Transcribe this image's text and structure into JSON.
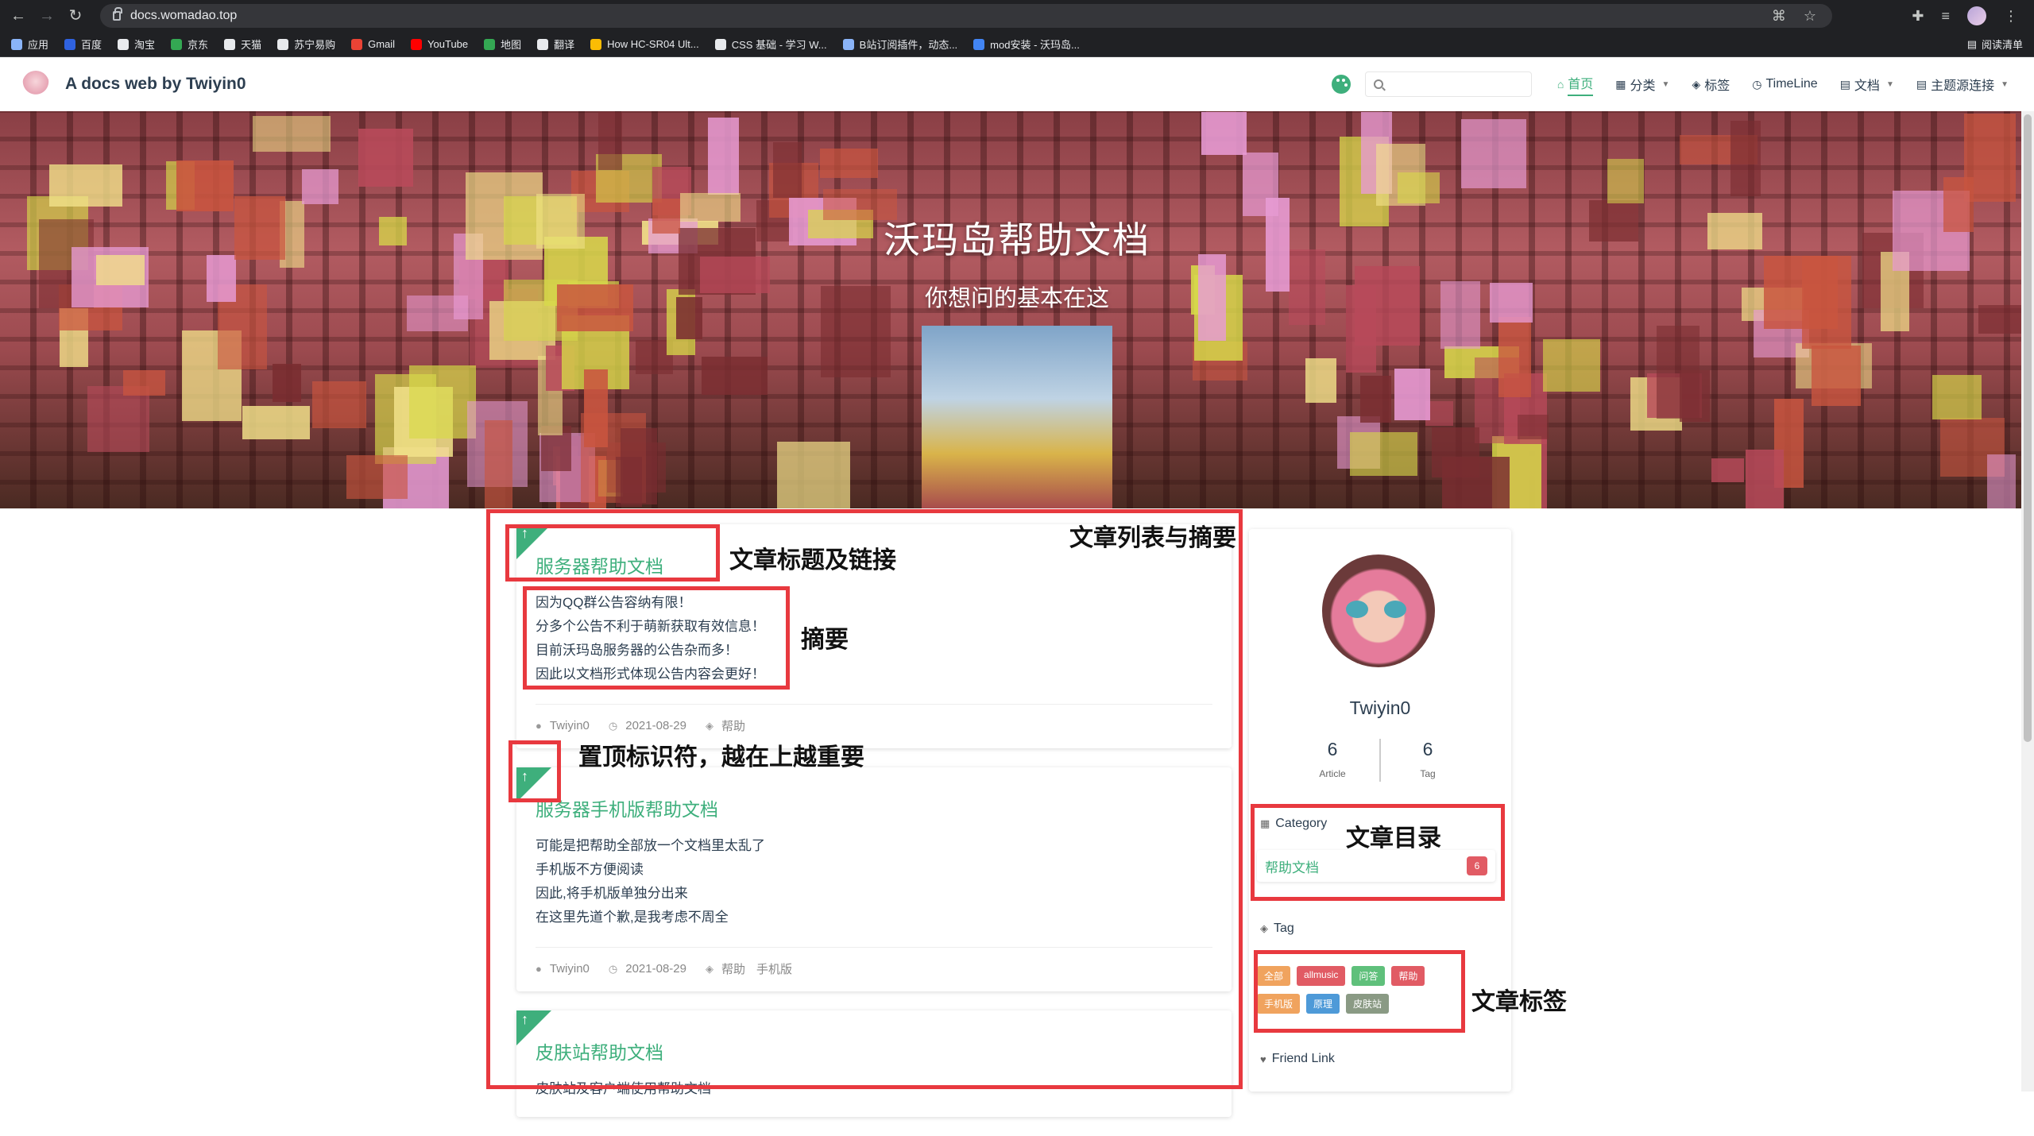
{
  "browser": {
    "url": "docs.womadao.top",
    "bookmarks": [
      {
        "label": "应用",
        "color": "#8ab4f8"
      },
      {
        "label": "百度",
        "color": "#2f62e0"
      },
      {
        "label": "淘宝",
        "color": "#e8eaed"
      },
      {
        "label": "京东",
        "color": "#34a853"
      },
      {
        "label": "天猫",
        "color": "#e8eaed"
      },
      {
        "label": "苏宁易购",
        "color": "#e8eaed"
      },
      {
        "label": "Gmail",
        "color": "#ea4335"
      },
      {
        "label": "YouTube",
        "color": "#ff0000"
      },
      {
        "label": "地图",
        "color": "#34a853"
      },
      {
        "label": "翻译",
        "color": "#e8eaed"
      },
      {
        "label": "How HC-SR04 Ult...",
        "color": "#fbbc04"
      },
      {
        "label": "CSS 基础 - 学习 W...",
        "color": "#e8eaed"
      },
      {
        "label": "B站订阅插件，动态...",
        "color": "#8ab4f8"
      },
      {
        "label": "mod安装 - 沃玛岛...",
        "color": "#4285f4"
      }
    ],
    "reading_list": "阅读清单"
  },
  "header": {
    "site_title": "A docs web by Twiyin0",
    "search_placeholder": "",
    "nav": [
      {
        "label": "首页",
        "icon": "home-icon",
        "glyph": "⌂",
        "active": true,
        "dropdown": false
      },
      {
        "label": "分类",
        "icon": "grid-icon",
        "glyph": "▦",
        "active": false,
        "dropdown": true
      },
      {
        "label": "标签",
        "icon": "tag-icon",
        "glyph": "◈",
        "active": false,
        "dropdown": false
      },
      {
        "label": "TimeLine",
        "icon": "clock-icon",
        "glyph": "◷",
        "active": false,
        "dropdown": false
      },
      {
        "label": "文档",
        "icon": "doc-icon",
        "glyph": "▤",
        "active": false,
        "dropdown": true
      },
      {
        "label": "主题源连接",
        "icon": "link-icon",
        "glyph": "▤",
        "active": false,
        "dropdown": true
      }
    ]
  },
  "hero": {
    "title": "沃玛岛帮助文档",
    "subtitle": "你想问的基本在这"
  },
  "articles": [
    {
      "title": "服务器帮助文档",
      "abstract": [
        "因为QQ群公告容纳有限！",
        "分多个公告不利于萌新获取有效信息！",
        "目前沃玛岛服务器的公告杂而多！",
        "因此以文档形式体现公告内容会更好！"
      ],
      "author": "Twiyin0",
      "date": "2021-08-29",
      "tags": [
        "帮助"
      ]
    },
    {
      "title": "服务器手机版帮助文档",
      "abstract": [
        "可能是把帮助全部放一个文档里太乱了",
        "手机版不方便阅读",
        "因此,将手机版单独分出来",
        "在这里先道个歉,是我考虑不周全"
      ],
      "author": "Twiyin0",
      "date": "2021-08-29",
      "tags": [
        "帮助",
        "手机版"
      ]
    },
    {
      "title": "皮肤站帮助文档",
      "abstract": [
        "皮肤站及客户端使用帮助文档"
      ],
      "author": "",
      "date": "",
      "tags": []
    }
  ],
  "sidebar": {
    "author": "Twiyin0",
    "stats": [
      {
        "num": "6",
        "label": "Article"
      },
      {
        "num": "6",
        "label": "Tag"
      }
    ],
    "category_title": "Category",
    "categories": [
      {
        "name": "帮助文档",
        "count": "6"
      }
    ],
    "tag_title": "Tag",
    "tags": [
      {
        "label": "全部",
        "color": "#f0a35e"
      },
      {
        "label": "allmusic",
        "color": "#e15b64"
      },
      {
        "label": "问答",
        "color": "#5fc07b"
      },
      {
        "label": "帮助",
        "color": "#e15b64"
      },
      {
        "label": "手机版",
        "color": "#f0a35e"
      },
      {
        "label": "原理",
        "color": "#4e9ad8"
      },
      {
        "label": "皮肤站",
        "color": "#8a9a84"
      }
    ],
    "friend_link_title": "Friend Link"
  },
  "annotations": {
    "list": "文章列表与摘要",
    "title": "文章标题及链接",
    "abstract": "摘要",
    "sticky": "置顶标识符，越在上越重要",
    "category": "文章目录",
    "tags": "文章标签"
  },
  "colors": {
    "accent": "#3eaf7c",
    "annotation": "#e8393f"
  }
}
